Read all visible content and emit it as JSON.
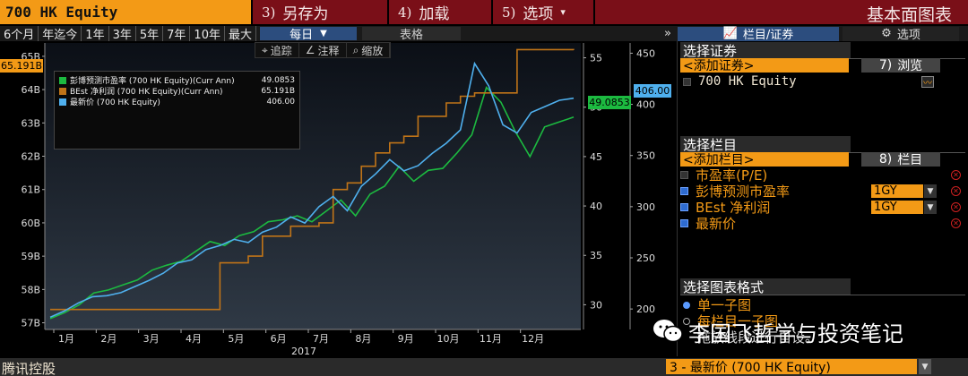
{
  "command_bar": {
    "ticker": "700 HK Equity",
    "saveas": {
      "num": "3)",
      "label": "另存为"
    },
    "load": {
      "num": "4)",
      "label": "加载"
    },
    "options": {
      "num": "5)",
      "label": "选项"
    },
    "title": "基本面图表"
  },
  "toolbar": {
    "ranges": [
      "6个月",
      "年迄今",
      "1年",
      "3年",
      "5年",
      "7年",
      "10年",
      "最大"
    ],
    "frequency": "每日",
    "table": "表格",
    "collapse": "»"
  },
  "chart_tools": {
    "track": "追踪",
    "annotate": "注释",
    "zoom": "缩放"
  },
  "panel_tabs": {
    "columns": "栏目/证券",
    "options": "选项"
  },
  "legend": [
    {
      "name": "彭博预测市盈率 (700 HK Equity)(Curr Ann)",
      "value": "49.0853",
      "color": "#1cba40"
    },
    {
      "name": "BEst 净利润 (700 HK Equity)(Curr Ann)",
      "value": "65.191B",
      "color": "#c07418"
    },
    {
      "name": "最新价 (700 HK Equity)",
      "value": "406.00",
      "color": "#4fb0ee"
    }
  ],
  "value_tags": {
    "left": "65.191B",
    "pe": "49.0853",
    "price": "406.00"
  },
  "chart_data": {
    "type": "line",
    "x": [
      "1月",
      "2月",
      "3月",
      "4月",
      "5月",
      "6月",
      "7月",
      "8月",
      "9月",
      "10月",
      "11月",
      "12月"
    ],
    "xlabel": "2017",
    "left_axis": {
      "ticks": [
        "57B",
        "58B",
        "59B",
        "60B",
        "61B",
        "62B",
        "63B",
        "64B",
        "65B"
      ],
      "range": [
        56.8,
        65.4
      ]
    },
    "pe_axis": {
      "ticks": [
        "30",
        "35",
        "40",
        "45",
        "50",
        "55"
      ],
      "range": [
        27.5,
        56.5
      ]
    },
    "price_axis": {
      "ticks": [
        "200",
        "250",
        "300",
        "350",
        "400",
        "450"
      ],
      "range": [
        180,
        460
      ]
    },
    "series": [
      {
        "name": "彭博预测市盈率 (700 HK Equity)(Curr Ann)",
        "axis": "pe",
        "color": "#1cba40",
        "values": [
          28.6,
          29.2,
          30.0,
          31.2,
          31.5,
          32.0,
          32.5,
          33.5,
          34.0,
          34.4,
          35.4,
          36.4,
          36.0,
          37.0,
          37.4,
          38.4,
          38.6,
          39.0,
          38.4,
          39.5,
          40.6,
          39.0,
          41.2,
          42.0,
          44.0,
          42.5,
          43.6,
          43.8,
          45.4,
          47.2,
          52.0,
          50.5,
          47.5,
          45.0,
          48.0,
          48.5,
          49.0
        ]
      },
      {
        "name": "BEst 净利润 (700 HK Equity)(Curr Ann)",
        "axis": "left",
        "color": "#c07418",
        "values": [
          57.4,
          57.4,
          57.4,
          57.4,
          57.4,
          57.4,
          57.4,
          57.4,
          57.4,
          57.4,
          57.4,
          57.4,
          58.8,
          58.8,
          59.0,
          59.6,
          59.6,
          59.9,
          59.9,
          60.0,
          61.0,
          61.2,
          61.7,
          62.1,
          62.4,
          62.6,
          63.2,
          63.2,
          63.6,
          63.8,
          63.9,
          63.9,
          63.9,
          65.2,
          65.2,
          65.2,
          65.2,
          65.19
        ]
      },
      {
        "name": "最新价 (700 HK Equity)",
        "axis": "price",
        "color": "#4fb0ee",
        "values": [
          192,
          198,
          206,
          212,
          213,
          216,
          222,
          228,
          235,
          245,
          248,
          258,
          262,
          268,
          265,
          275,
          280,
          290,
          284,
          300,
          310,
          296,
          320,
          332,
          346,
          335,
          340,
          352,
          362,
          375,
          440,
          418,
          380,
          372,
          392,
          398,
          404,
          406
        ]
      }
    ]
  },
  "right_panel": {
    "securities_title": "选择证券",
    "add_security": "<添加证券>",
    "browse": {
      "num": "7)",
      "label": "浏览"
    },
    "security": "700 HK Equity",
    "fields_title": "选择栏目",
    "add_field": "<添加栏目>",
    "field_btn": {
      "num": "8)",
      "label": "栏目"
    },
    "fields": [
      {
        "name": "市盈率(P/E)",
        "checked": false,
        "period": ""
      },
      {
        "name": "彭博预测市盈率",
        "checked": true,
        "period": "1GY"
      },
      {
        "name": "BEst 净利润",
        "checked": true,
        "period": "1GY"
      },
      {
        "name": "最新价",
        "checked": true,
        "period": ""
      }
    ],
    "format_title": "选择图表格式",
    "format_options": [
      "单一子图",
      "每栏目一子图",
      "拖放线段进行自设。"
    ]
  },
  "watermark": "李国飞哲学与投资笔记",
  "footer": {
    "name": "腾讯控股",
    "selection": "3 - 最新价 (700 HK Equity)"
  }
}
